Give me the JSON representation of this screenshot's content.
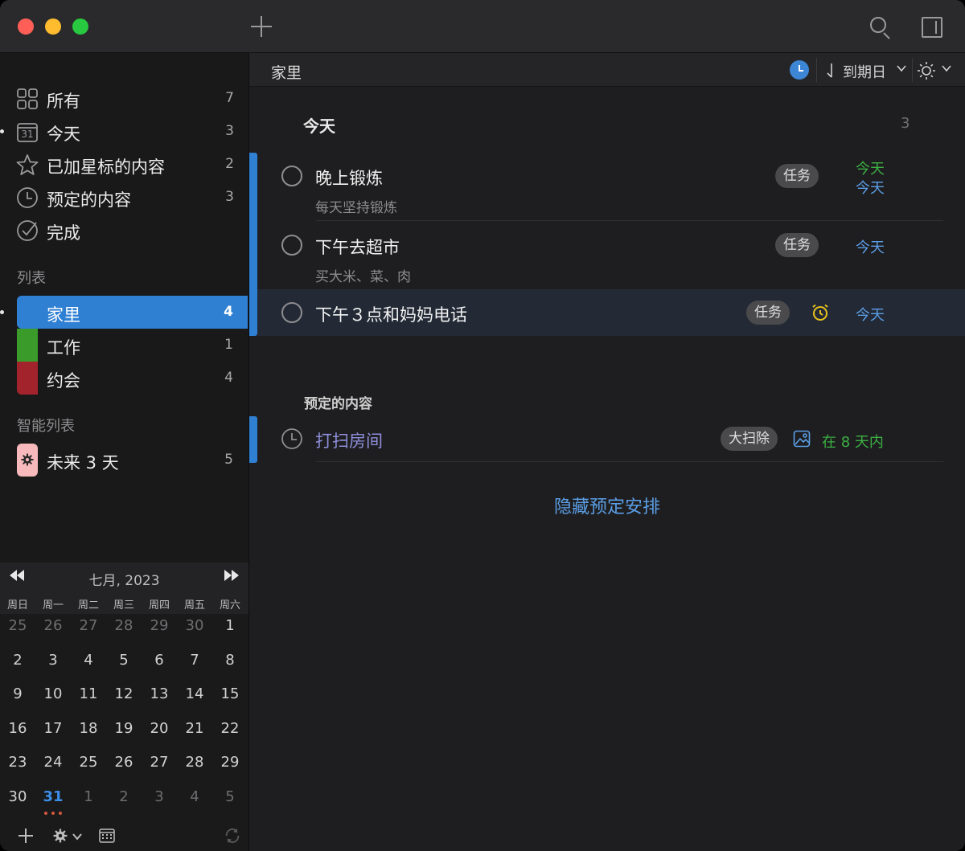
{
  "toolbar": {
    "new_item_icon": "plus-icon",
    "search_icon": "search-icon",
    "sidebar_toggle_icon": "panel-icon"
  },
  "sidebar": {
    "smart": [
      {
        "label": "所有",
        "count": "7",
        "icon": "grid-icon"
      },
      {
        "label": "今天",
        "count": "3",
        "icon": "calendar-icon",
        "icon_text": "31"
      },
      {
        "label": "已加星标的内容",
        "count": "2",
        "icon": "star-icon"
      },
      {
        "label": "预定的内容",
        "count": "3",
        "icon": "clock-icon"
      },
      {
        "label": "完成",
        "count": "",
        "icon": "check-icon"
      }
    ],
    "lists_heading": "列表",
    "lists": [
      {
        "label": "家里",
        "count": "4",
        "color": "#2f7fd3"
      },
      {
        "label": "工作",
        "count": "1",
        "color": "#3a9a2a"
      },
      {
        "label": "约会",
        "count": "4",
        "color": "#a3232d"
      }
    ],
    "smart_lists_heading": "智能列表",
    "smart_lists": [
      {
        "label": "未来 3 天",
        "count": "5",
        "color": "#f7b9bb",
        "icon": "gear-icon"
      }
    ]
  },
  "calendar": {
    "title": "七月, 2023",
    "weekdays": [
      "周日",
      "周一",
      "周二",
      "周三",
      "周四",
      "周五",
      "周六"
    ],
    "weeks": [
      [
        "25",
        "26",
        "27",
        "28",
        "29",
        "30",
        "1"
      ],
      [
        "2",
        "3",
        "4",
        "5",
        "6",
        "7",
        "8"
      ],
      [
        "9",
        "10",
        "11",
        "12",
        "13",
        "14",
        "15"
      ],
      [
        "16",
        "17",
        "18",
        "19",
        "20",
        "21",
        "22"
      ],
      [
        "23",
        "24",
        "25",
        "26",
        "27",
        "28",
        "29"
      ],
      [
        "30",
        "31",
        "1",
        "2",
        "3",
        "4",
        "5"
      ]
    ],
    "today": "31"
  },
  "main": {
    "title": "家里",
    "sort_label": "到期日",
    "today_group": {
      "title": "今天",
      "count": "3"
    },
    "tasks": [
      {
        "title": "晚上锻炼",
        "note": "每天坚持锻炼",
        "tag": "任务",
        "due_primary": "今天",
        "due_secondary": "今天"
      },
      {
        "title": "下午去超市",
        "note": "买大米、菜、肉",
        "tag": "任务",
        "due_primary": "今天"
      },
      {
        "title": "下午３点和妈妈电话",
        "note": "",
        "tag": "任务",
        "due_primary": "今天",
        "alarm_icon": "alarm-icon"
      }
    ],
    "scheduled_group": {
      "title": "预定的内容"
    },
    "scheduled_tasks": [
      {
        "title": "打扫房间",
        "tag": "大扫除",
        "due": "在 8 天内",
        "icon": "photo-icon"
      }
    ],
    "hide_button": "隐藏预定安排"
  },
  "colors": {
    "accent": "#2f7fd3",
    "due_green": "#3cb043",
    "due_blue": "#5b9ee6",
    "scheduled_title": "#8f8fdc",
    "alarm": "#e8c21c"
  }
}
